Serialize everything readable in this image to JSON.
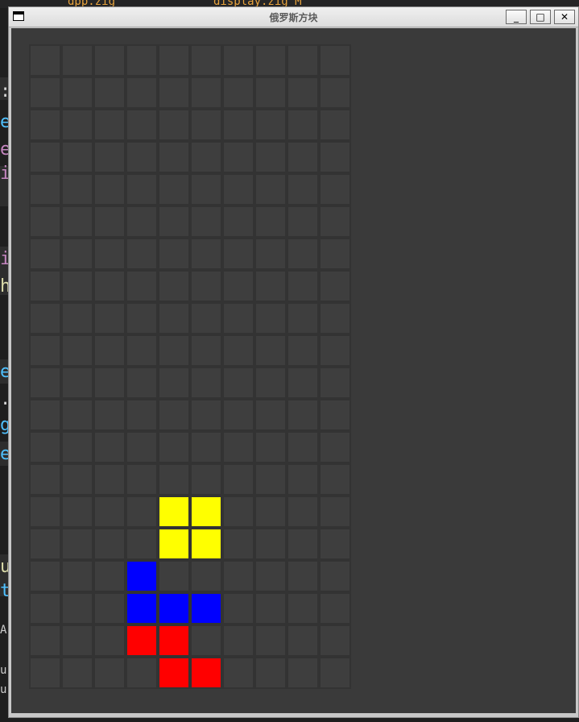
{
  "window": {
    "title": "俄罗斯方块",
    "buttons": {
      "minimize": "_",
      "maximize": "□",
      "close": "✕"
    }
  },
  "background": {
    "tabs": [
      "dpp.zig",
      "display.zig M"
    ],
    "code_fragments": [
      {
        "text": ":",
        "color": "#d4d4d4"
      },
      {
        "text": "e",
        "color": "#4fc1ff"
      },
      {
        "text": "e",
        "color": "#c586c0"
      },
      {
        "text": "i",
        "color": "#c586c0"
      },
      {
        "text": "i",
        "color": "#c586c0"
      },
      {
        "text": "h",
        "color": "#dcdcaa"
      },
      {
        "text": "e",
        "color": "#4fc1ff"
      },
      {
        "text": ".",
        "color": "#d4d4d4"
      },
      {
        "text": "g",
        "color": "#4fc1ff"
      },
      {
        "text": "e",
        "color": "#4fc1ff"
      },
      {
        "text": "u",
        "color": "#dcdcaa"
      },
      {
        "text": "t",
        "color": "#4fc1ff"
      },
      {
        "text": "A",
        "color": "#cccccc"
      },
      {
        "text": "u",
        "color": "#cccccc"
      },
      {
        "text": "u",
        "color": "#cccccc"
      }
    ]
  },
  "game": {
    "board": {
      "columns": 10,
      "rows": 20
    },
    "colors": {
      "empty_cell": "#3e3e3e",
      "yellow": "#ffff00",
      "blue": "#0000ff",
      "red": "#ff0000"
    },
    "filled_cells": [
      {
        "col": 4,
        "row": 14,
        "color": "yellow",
        "piece": "O"
      },
      {
        "col": 5,
        "row": 14,
        "color": "yellow",
        "piece": "O"
      },
      {
        "col": 4,
        "row": 15,
        "color": "yellow",
        "piece": "O"
      },
      {
        "col": 5,
        "row": 15,
        "color": "yellow",
        "piece": "O"
      },
      {
        "col": 3,
        "row": 16,
        "color": "blue",
        "piece": "J"
      },
      {
        "col": 3,
        "row": 17,
        "color": "blue",
        "piece": "J"
      },
      {
        "col": 4,
        "row": 17,
        "color": "blue",
        "piece": "J"
      },
      {
        "col": 5,
        "row": 17,
        "color": "blue",
        "piece": "J"
      },
      {
        "col": 3,
        "row": 18,
        "color": "red",
        "piece": "Z"
      },
      {
        "col": 4,
        "row": 18,
        "color": "red",
        "piece": "Z"
      },
      {
        "col": 4,
        "row": 19,
        "color": "red",
        "piece": "Z"
      },
      {
        "col": 5,
        "row": 19,
        "color": "red",
        "piece": "Z"
      }
    ]
  }
}
